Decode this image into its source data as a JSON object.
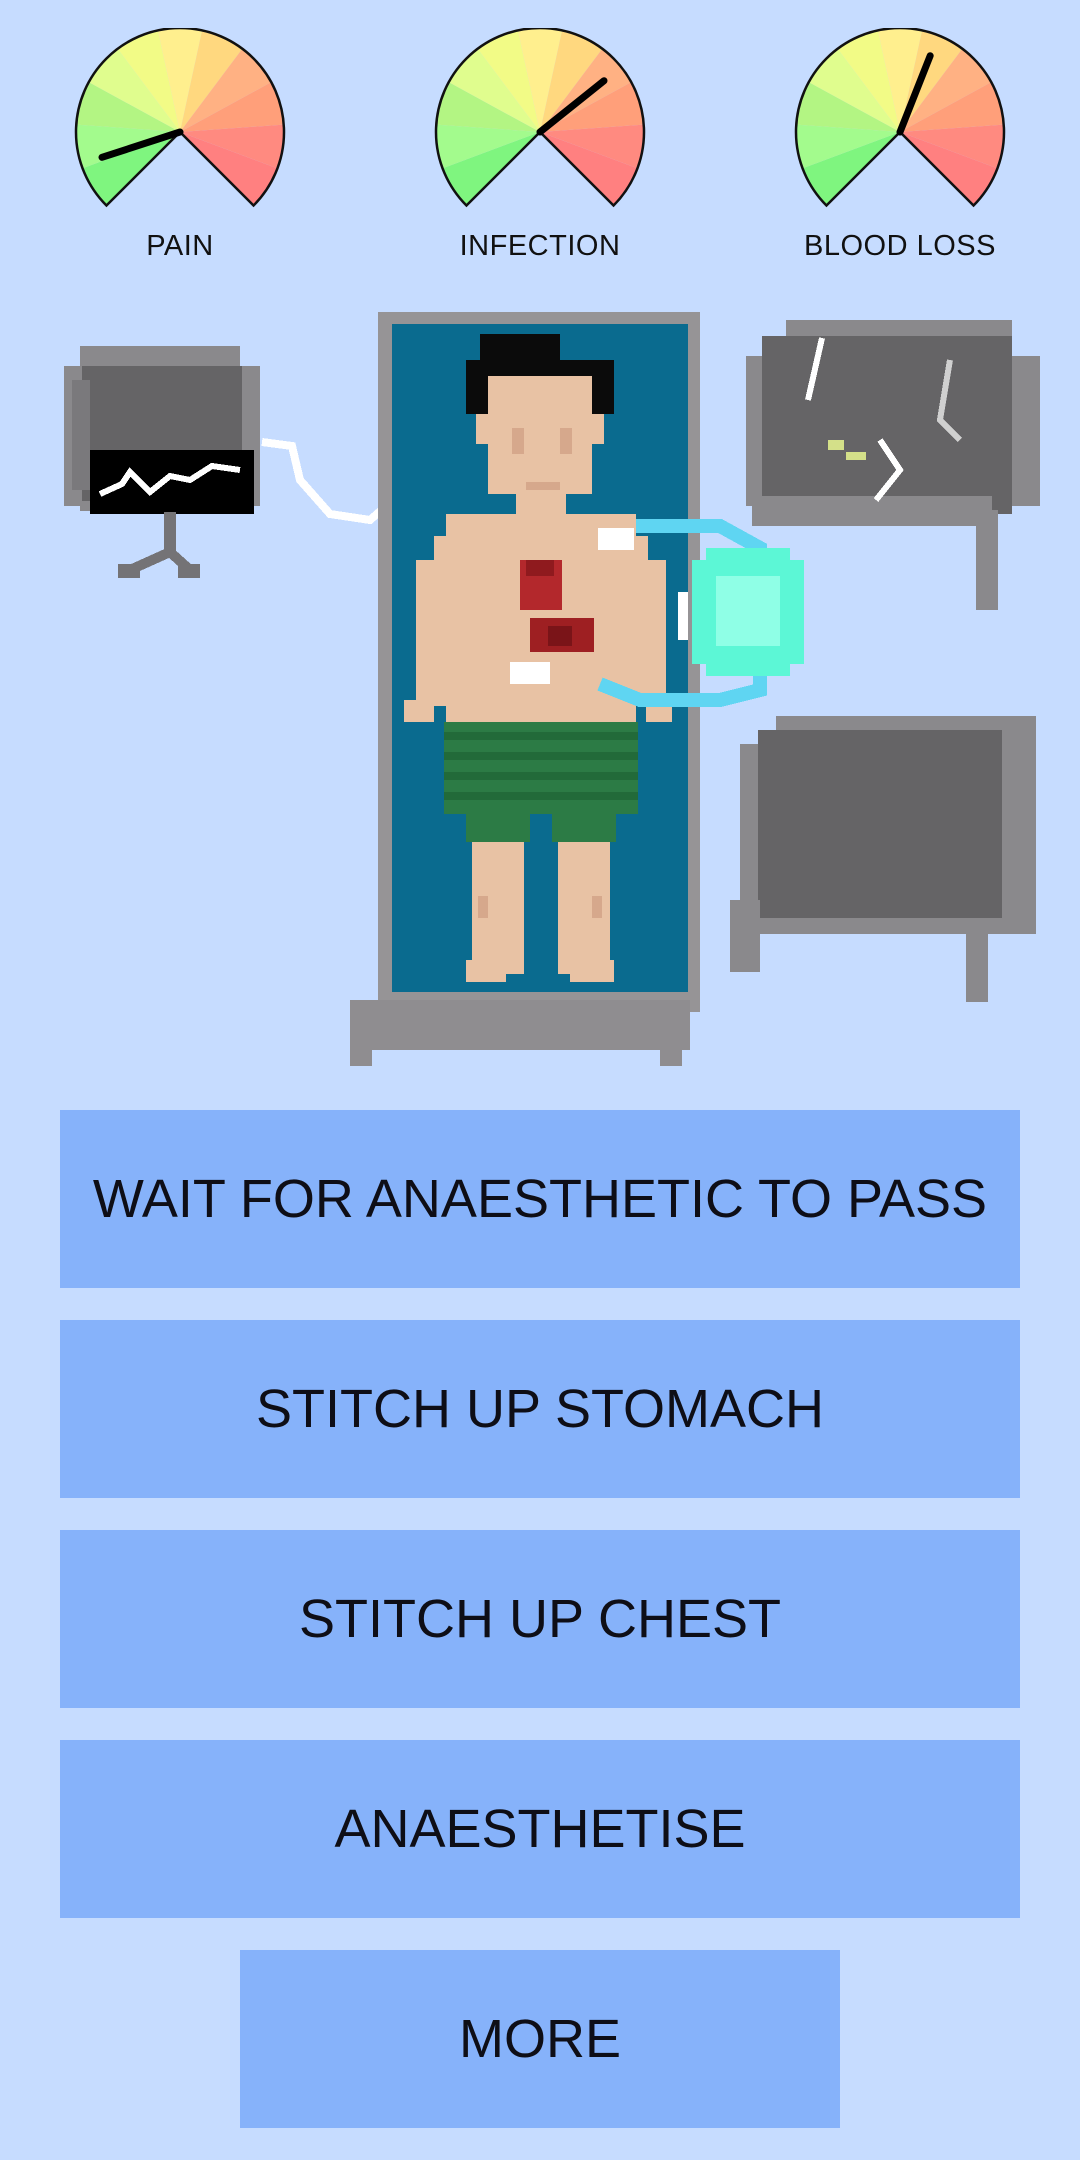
{
  "gauges": [
    {
      "id": "pain",
      "label": "PAIN",
      "level": 0.1
    },
    {
      "id": "infection",
      "label": "INFECTION",
      "level": 0.69
    },
    {
      "id": "blood",
      "label": "BLOOD LOSS",
      "level": 0.58
    }
  ],
  "actions": [
    {
      "label": "WAIT FOR ANAESTHETIC TO PASS"
    },
    {
      "label": "STITCH UP STOMACH"
    },
    {
      "label": "STITCH UP CHEST"
    },
    {
      "label": "ANAESTHETISE"
    }
  ],
  "more_label": "MORE",
  "colors": {
    "background": "#c6dcff",
    "button": "#86b2fa",
    "bed": "#0a6b8f",
    "bed_frame": "#969496",
    "monitor": "#656466",
    "heal_orb": "#5cf7d6"
  }
}
